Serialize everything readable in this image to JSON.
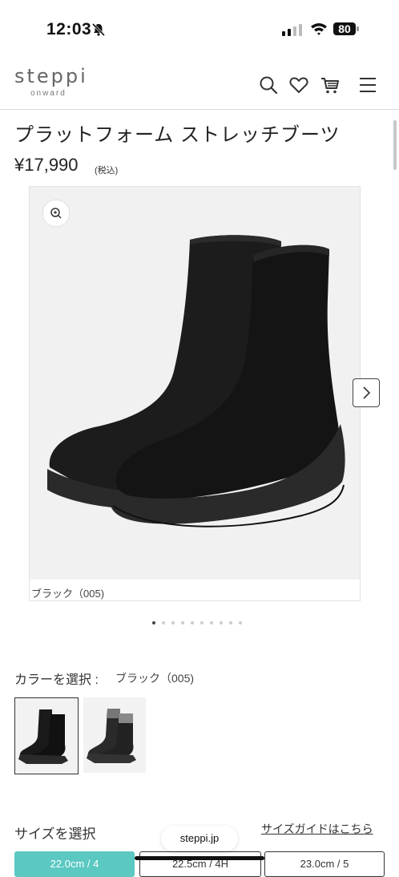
{
  "status": {
    "time": "12:03",
    "battery": "80"
  },
  "header": {
    "logo": "steppi",
    "logo_sub": "onward"
  },
  "product": {
    "title": "プラットフォーム ストレッチブーツ",
    "price": "¥17,990",
    "tax_note": "(税込)",
    "image_caption": "ブラック（005)"
  },
  "gallery": {
    "dot_count": 10,
    "active_dot": 0
  },
  "color": {
    "label": "カラーを選択 :",
    "value": "ブラック（005)",
    "swatches": [
      "black",
      "black-gray-cuff"
    ],
    "selected_index": 0
  },
  "size": {
    "label": "サイズを選択",
    "guide_link": "サイズガイドはこちら",
    "options": [
      "22.0cm / 4",
      "22.5cm / 4H",
      "23.0cm / 5"
    ],
    "selected_index": 0
  },
  "browser": {
    "url": "steppi.jp"
  },
  "colors": {
    "accent": "#5bc8c2",
    "text": "#222222"
  }
}
